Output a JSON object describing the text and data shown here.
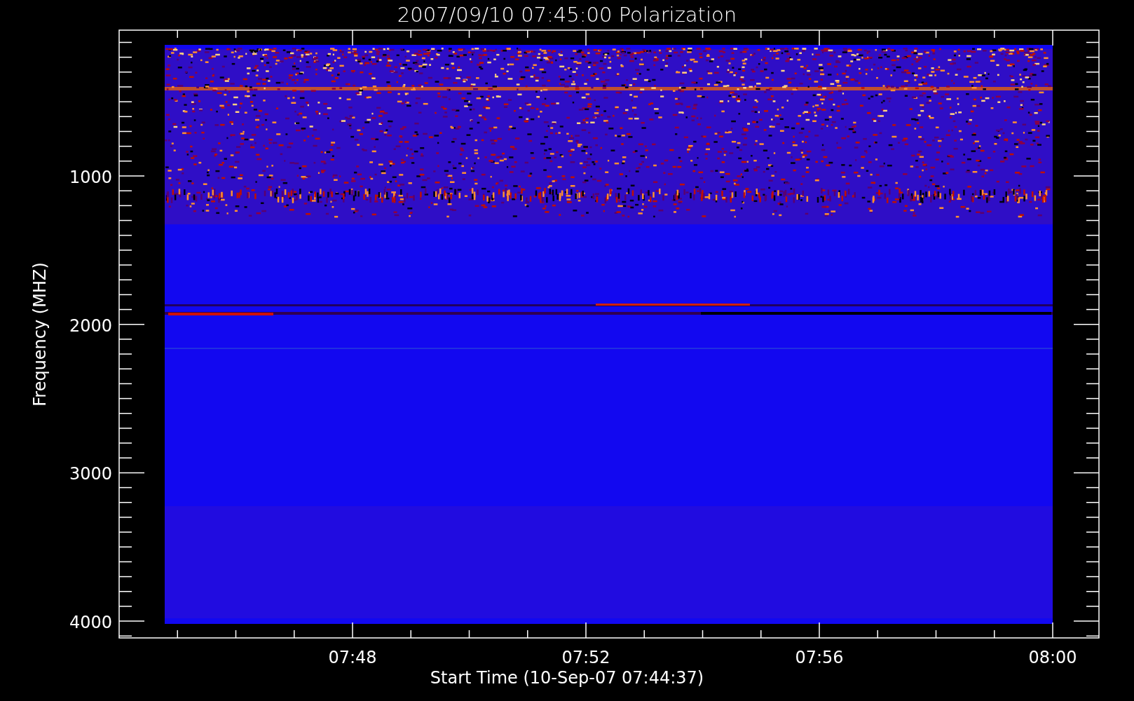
{
  "title": "2007/09/10 07:45:00 Polarization",
  "plot": {
    "xlabel": "Start Time (10-Sep-07 07:44:37)",
    "ylabel": "Frequency (MHZ)",
    "xtick_labels": [
      "07:48",
      "07:52",
      "07:56",
      "08:00"
    ],
    "ytick_labels": [
      "1000",
      "2000",
      "3000",
      "4000"
    ]
  }
}
